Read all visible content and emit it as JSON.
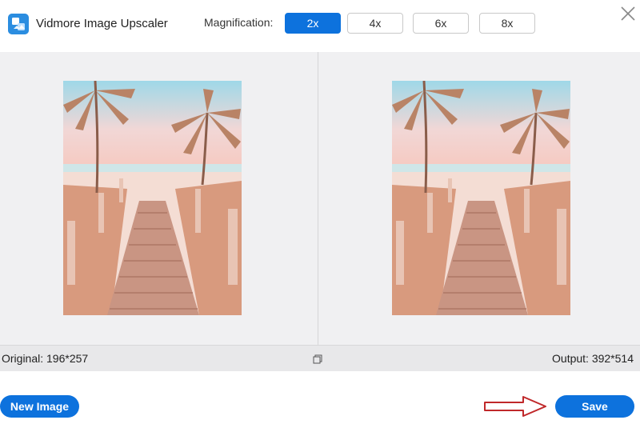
{
  "header": {
    "app_title": "Vidmore Image Upscaler",
    "magnification_label": "Magnification:",
    "magnification_options": [
      {
        "label": "2x",
        "active": true
      },
      {
        "label": "4x",
        "active": false
      },
      {
        "label": "6x",
        "active": false
      },
      {
        "label": "8x",
        "active": false
      }
    ],
    "logo_icon": "vidmore-logo-icon",
    "close_icon": "close-icon"
  },
  "preview": {
    "original_image": "beach-boardwalk-palms-photo",
    "output_image": "beach-boardwalk-palms-photo"
  },
  "infobar": {
    "original_text": "Original: 196*257",
    "output_text": "Output: 392*514",
    "compare_icon": "compare-icon"
  },
  "footer": {
    "new_image_label": "New Image",
    "save_label": "Save",
    "arrow_icon": "arrow-right-icon"
  },
  "colors": {
    "accent": "#0d72dd",
    "panel_bg": "#f0f0f2",
    "arrow_red": "#c0282a"
  }
}
